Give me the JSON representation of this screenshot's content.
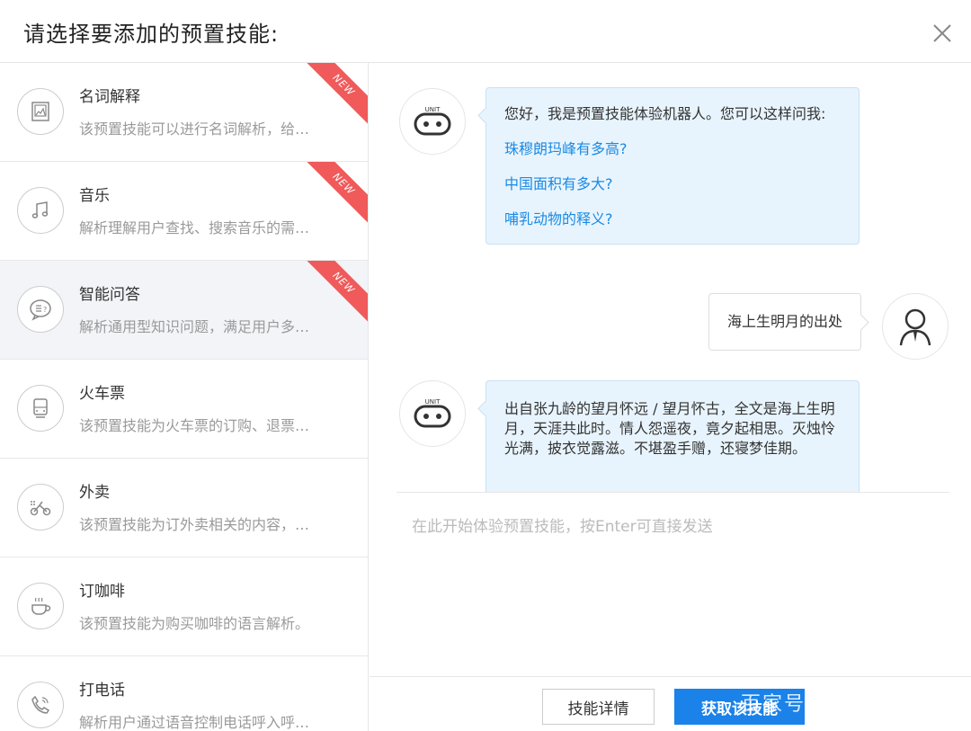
{
  "header": {
    "title": "请选择要添加的预置技能:",
    "close_icon": "close-icon"
  },
  "skills": [
    {
      "name": "名词解释",
      "desc": "该预置技能可以进行名词解析，给…",
      "badge": "NEW",
      "icon": "dictionary-icon"
    },
    {
      "name": "音乐",
      "desc": "解析理解用户查找、搜索音乐的需…",
      "badge": "NEW",
      "icon": "music-note-icon"
    },
    {
      "name": "智能问答",
      "desc": "解析通用型知识问题，满足用户多…",
      "badge": "NEW",
      "icon": "chat-question-icon"
    },
    {
      "name": "火车票",
      "desc": "该预置技能为火车票的订购、退票…",
      "icon": "train-icon"
    },
    {
      "name": "外卖",
      "desc": "该预置技能为订外卖相关的内容，…",
      "icon": "bike-delivery-icon"
    },
    {
      "name": "订咖啡",
      "desc": "该预置技能为购买咖啡的语言解析。",
      "icon": "coffee-cup-icon"
    },
    {
      "name": "打电话",
      "desc": "解析用户通过语音控制电话呼入呼…",
      "icon": "phone-icon"
    }
  ],
  "chat": {
    "bot_label": "UNIT",
    "greeting": "您好，我是预置技能体验机器人。您可以这样问我:",
    "suggestions": [
      "珠穆朗玛峰有多高?",
      "中国面积有多大?",
      "哺乳动物的释义?"
    ],
    "user_message": "海上生明月的出处",
    "bot_reply": "出自张九龄的望月怀远 / 望月怀古，全文是海上生明月，天涯共此时。情人怨遥夜，竟夕起相思。灭烛怜光满，披衣觉露滋。不堪盈手赠，还寝梦佳期。"
  },
  "input": {
    "placeholder": "在此开始体验预置技能，按Enter可直接发送",
    "value": ""
  },
  "footer": {
    "detail_label": "技能详情",
    "add_label": "获取该技能"
  },
  "watermark": "百家号",
  "colors": {
    "accent": "#1a82e8",
    "link": "#1a8ae4",
    "badge": "#f05a5a",
    "bubble_bg": "#e8f4fd",
    "active_bg": "#f2f4f8"
  }
}
